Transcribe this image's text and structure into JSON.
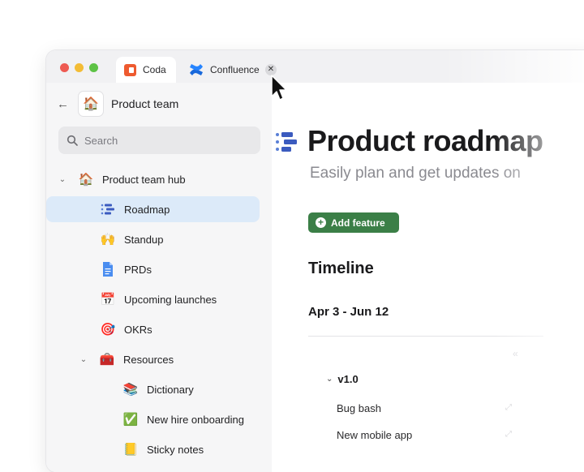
{
  "browser": {
    "tabs": [
      {
        "label": "Coda",
        "icon": "coda-logo-icon",
        "active": true
      },
      {
        "label": "Confluence",
        "icon": "confluence-logo-icon",
        "active": false
      }
    ],
    "close_glyph": "✕"
  },
  "sidebar": {
    "back_glyph": "←",
    "workspace_icon": "🏠",
    "title": "Product team",
    "search_placeholder": "Search",
    "items": [
      {
        "label": "Product team hub",
        "icon": "🏠",
        "icon_name": "house-icon",
        "expanded": true
      },
      {
        "label": "Roadmap",
        "icon_name": "roadmap-icon",
        "selected": true
      },
      {
        "label": "Standup",
        "icon": "🙌",
        "icon_name": "raised-hands-icon"
      },
      {
        "label": "PRDs",
        "icon_name": "document-icon"
      },
      {
        "label": "Upcoming launches",
        "icon": "📅",
        "icon_name": "calendar-icon"
      },
      {
        "label": "OKRs",
        "icon": "🎯",
        "icon_name": "target-icon"
      },
      {
        "label": "Resources",
        "icon": "🧰",
        "icon_name": "toolbox-icon",
        "expanded": true
      },
      {
        "label": "Dictionary",
        "icon": "📚",
        "icon_name": "books-icon"
      },
      {
        "label": "New hire onboarding",
        "icon": "✅",
        "icon_name": "checkbox-icon"
      },
      {
        "label": "Sticky notes",
        "icon": "📒",
        "icon_name": "sticky-note-icon"
      }
    ]
  },
  "main": {
    "title": "Product roadmap",
    "subtitle": "Easily plan and get updates on",
    "add_button": "Add feature",
    "section_title": "Timeline",
    "date_range": "Apr 3 - Jun 12",
    "group": "v1.0",
    "rows": [
      "Bug bash",
      "New mobile app"
    ]
  },
  "colors": {
    "accent_green": "#3b7f47",
    "selected_bg": "#dceaf9",
    "coda_orange": "#ee5a2f",
    "confluence_blue": "#1868db"
  }
}
